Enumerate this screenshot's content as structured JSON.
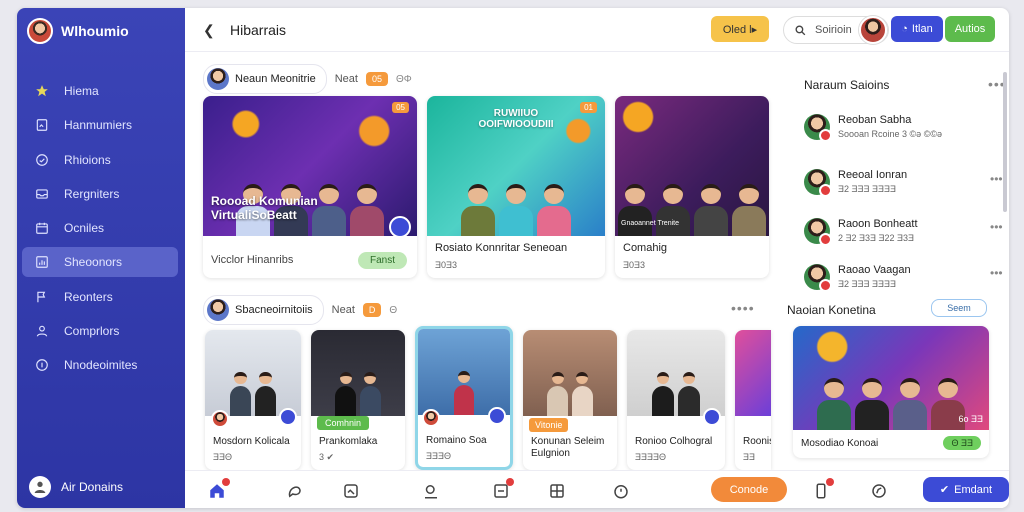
{
  "brand": {
    "name": "Wlhoumio"
  },
  "sidebar": {
    "items": [
      {
        "label": "Hiema",
        "icon": "star-icon"
      },
      {
        "label": "Hanmumiers",
        "icon": "document-icon"
      },
      {
        "label": "Rhioions",
        "icon": "clock-icon"
      },
      {
        "label": "Rergniters",
        "icon": "inbox-icon"
      },
      {
        "label": "Ocniles",
        "icon": "calendar-icon"
      },
      {
        "label": "Sheoonors",
        "icon": "chart-icon",
        "active": true
      },
      {
        "label": "Reonters",
        "icon": "flag-icon"
      },
      {
        "label": "Comprlors",
        "icon": "user-icon"
      },
      {
        "label": "Nnodeoimites",
        "icon": "info-icon"
      }
    ],
    "user": {
      "label": "Air Donains"
    }
  },
  "header": {
    "title": "Hibarrais",
    "yellow_button": "Oled l▸",
    "search_placeholder": "Soirioin",
    "blue_button": "Itlan",
    "green_button": "Autios"
  },
  "feed": {
    "section1": {
      "name": "Neaun Meonitrie",
      "next": "Neat",
      "badge": "05",
      "extra": "ΘΦ"
    },
    "section2": {
      "name": "Sbacneoirnitoiis",
      "next": "Neat",
      "badge": "D",
      "extra": "Θ"
    },
    "featured": [
      {
        "overlay": "Roooad Komunian\nVirtualiSoBeatt",
        "caption": "Vicclor Hinanribs",
        "action": "Fanst",
        "tag": "05"
      },
      {
        "overlay_top": "RUWIIUO\nOOIFWIOOUDIII",
        "caption": "Rosiato Konnritar Seneoan",
        "sub": "Ǝ0Ǝ3",
        "tag": "01"
      },
      {
        "overlay_bottom": "Gnaoannet Trenite",
        "caption": "Comahig",
        "sub": "Ǝ0Ǝ3"
      }
    ],
    "row2": [
      {
        "caption": "Mosdorn Kolicala",
        "sub": "ƎƎΘ"
      },
      {
        "tag": "Comhnin",
        "caption": "Prankomlaka",
        "sub": "3 ✔"
      },
      {
        "caption": "Romaino Soa",
        "sub": "ƎƎƎΘ"
      },
      {
        "tag": "Vitonie",
        "caption": "Konunan Seleim\nEulgnion",
        "sub": ""
      },
      {
        "caption": "Ronioo Colhogral",
        "sub": "ƎƎƎƎΘ"
      },
      {
        "caption": "Roonis",
        "sub": "ƎƎ"
      }
    ]
  },
  "right_panel": {
    "title": "Naraum Saioins",
    "contacts": [
      {
        "name": "Reoban Sabha",
        "meta": "Soooan Rcoine 3 ©ǝ ©©ǝ"
      },
      {
        "name": "Reeoal Ionran",
        "meta": "Ǝ2 ƎƎƎ ƎƎƎƎ"
      },
      {
        "name": "Raoon Bonheatt",
        "meta": "2 Ǝ2 Ǝ3Ǝ Ǝ22 Ǝ3Ǝ"
      },
      {
        "name": "Raoao Vaagan",
        "meta": "Ǝ2 ƎƎƎ ƎƎƎƎ"
      }
    ],
    "section2_title": "Naoian Konetina",
    "section2_button": "Seem",
    "featured": {
      "caption": "Mosodiao Konoai",
      "tag": "6o ƎƎ",
      "pill": "Θ ƎƎ"
    }
  },
  "bottombar": {
    "orange_button": "Conode",
    "blue_button": "Emdant"
  }
}
